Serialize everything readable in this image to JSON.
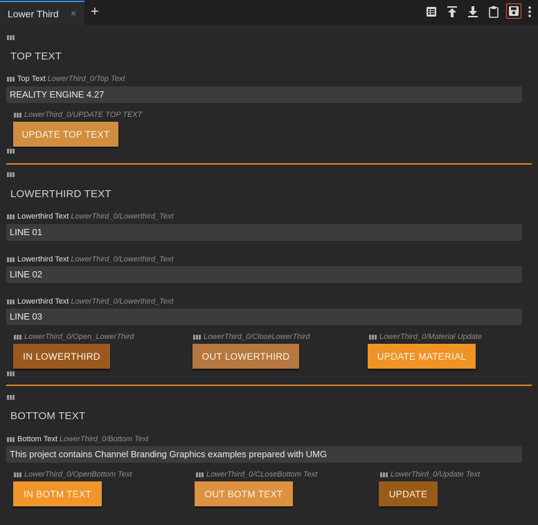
{
  "tab": {
    "title": "Lower Third",
    "close_glyph": "×",
    "add_glyph": "+"
  },
  "toolbar": [
    {
      "icon": "list-view-icon"
    },
    {
      "icon": "upload-icon"
    },
    {
      "icon": "download-icon"
    },
    {
      "icon": "clipboard-icon"
    },
    {
      "icon": "save-icon"
    },
    {
      "icon": "more-vertical-icon"
    }
  ],
  "colors": {
    "accent": "#e08a22",
    "tab_highlight": "#3a8fd8",
    "save_outline": "#e0603a"
  },
  "top": {
    "title": "TOP TEXT",
    "field_label": "Top Text",
    "field_path": "LowerThird_0/Top Text",
    "field_value": "REALITY ENGINE 4.27",
    "button_path": "LowerThird_0/UPDATE TOP TEXT",
    "button_label": "UPDATE TOP TEXT"
  },
  "lower": {
    "title": "LOWERTHIRD TEXT",
    "fields": [
      {
        "label": "Lowerthird Text",
        "path": "LowerThird_0/Lowerthird_Text",
        "value": "LINE 01"
      },
      {
        "label": "Lowerthird Text",
        "path": "LowerThird_0/Lowerthird_Text",
        "value": "LINE 02"
      },
      {
        "label": "Lowerthird Text",
        "path": "LowerThird_0/Lowerthird_Text",
        "value": "LINE 03"
      }
    ],
    "buttons": [
      {
        "path": "LowerThird_0/Open_LowerThird",
        "label": "IN LOWERTHIRD"
      },
      {
        "path": "LowerThird_0/CloseLowerThird",
        "label": "OUT LOWERTHIRD"
      },
      {
        "path": "LowerThird_0/Material Update",
        "label": "UPDATE MATERIAL"
      }
    ]
  },
  "bottom": {
    "title": "BOTTOM TEXT",
    "field_label": "Bottom Text",
    "field_path": "LowerThird_0/Bottom Text",
    "field_value": "This project contains Channel Branding Graphics examples prepared with UMG",
    "buttons": [
      {
        "path": "LowerThird_0/OpenBottom Text",
        "label": "IN BOTM TEXT"
      },
      {
        "path": "LowerThird_0/CLoseBottom Text",
        "label": "OUT BOTM TEXT"
      },
      {
        "path": "LowerThird_0/Update Text",
        "label": "UPDATE"
      }
    ]
  }
}
